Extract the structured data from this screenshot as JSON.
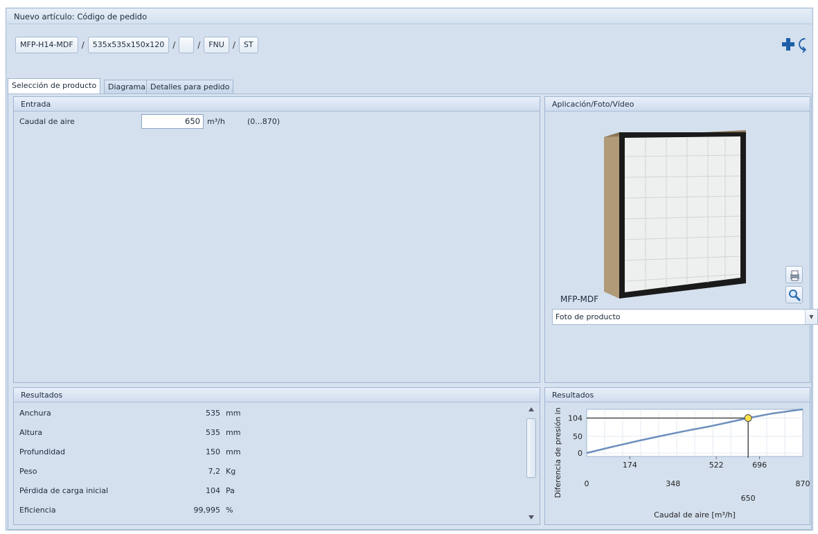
{
  "header": {
    "title": "Nuevo artículo: Código de pedido"
  },
  "order_code": {
    "segments": [
      "MFP-H14-MDF",
      "535x535x150x120",
      "",
      "FNU",
      "ST"
    ],
    "separator": "/"
  },
  "toolbar": {
    "add_icon": "plus-icon",
    "undo_icon": "undo-icon"
  },
  "tabs": [
    {
      "label": "Selección de producto",
      "active": true
    },
    {
      "label": "Diagrama",
      "active": false
    },
    {
      "label": "Detalles para pedido",
      "active": false
    }
  ],
  "input_panel": {
    "title": "Entrada",
    "airflow": {
      "label": "Caudal de aire",
      "value": "650",
      "unit": "m³/h",
      "range": "(0...870)"
    }
  },
  "media_panel": {
    "title": "Aplicación/Foto/Vídeo",
    "caption": "MFP-MDF",
    "select_value": "Foto de producto",
    "print_icon": "printer-icon",
    "zoom_icon": "magnifier-icon"
  },
  "results_panel": {
    "title": "Resultados",
    "rows": [
      {
        "name": "Anchura",
        "value": "535",
        "unit": "mm"
      },
      {
        "name": "Altura",
        "value": "535",
        "unit": "mm"
      },
      {
        "name": "Profundidad",
        "value": "150",
        "unit": "mm"
      },
      {
        "name": "Peso",
        "value": "7,2",
        "unit": "Kg"
      },
      {
        "name": "Pérdida de carga inicial",
        "value": "104",
        "unit": "Pa"
      },
      {
        "name": "Eficiencia",
        "value": "99,995",
        "unit": "%"
      }
    ]
  },
  "chart_panel": {
    "title": "Resultados"
  },
  "chart_data": {
    "type": "line",
    "ylabel": "Diferencia de presión in",
    "xlabel": "Caudal de aire [m³/h]",
    "yticks": [
      0,
      50,
      104
    ],
    "xticks_upper": [
      174,
      522,
      696
    ],
    "xticks_lower": [
      0,
      348,
      870
    ],
    "operating_x_label": 650,
    "xlim": [
      0,
      870
    ],
    "ylim": [
      -10,
      130
    ],
    "series": [
      {
        "x": [
          0,
          100,
          200,
          300,
          400,
          500,
          600,
          650,
          750,
          870
        ],
        "y": [
          0,
          18,
          35,
          51,
          66,
          80,
          96,
          104,
          118,
          130
        ]
      }
    ],
    "operating_point": {
      "x": 650,
      "y": 104
    },
    "grid": true
  }
}
